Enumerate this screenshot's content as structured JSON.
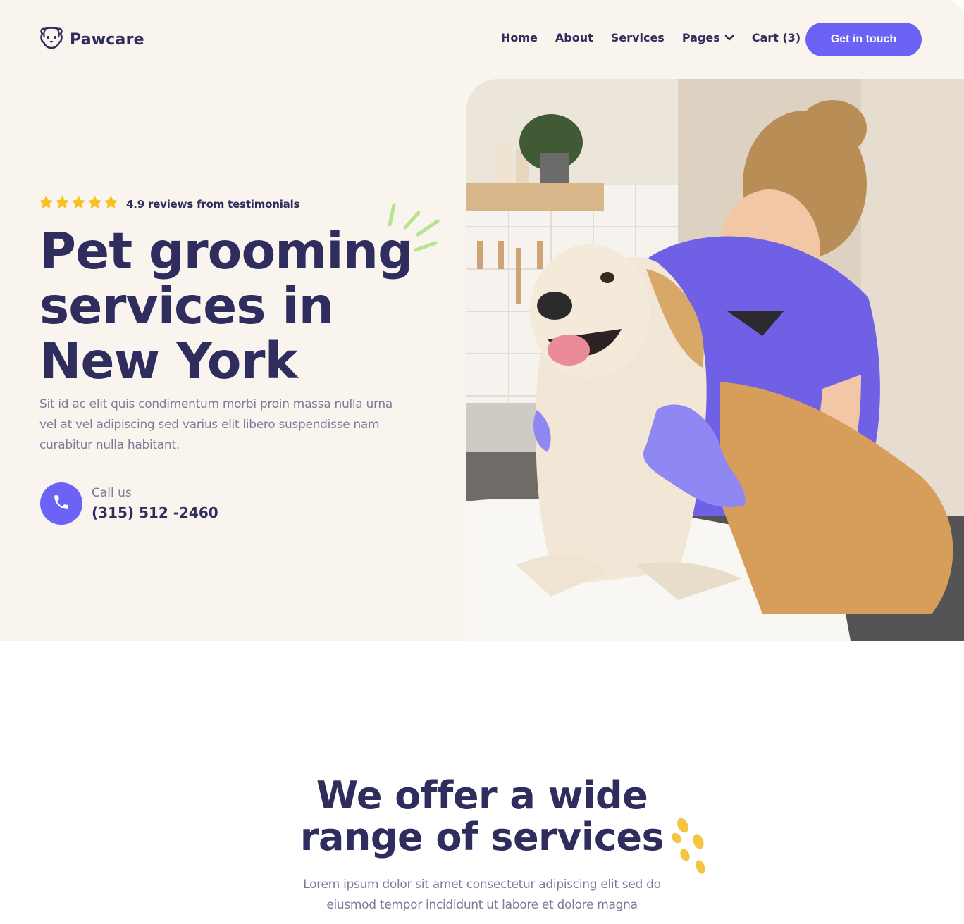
{
  "brand": {
    "name": "Pawcare",
    "logo_icon": "dog-face-icon"
  },
  "nav": {
    "items": [
      {
        "label": "Home"
      },
      {
        "label": "About"
      },
      {
        "label": "Services"
      },
      {
        "label": "Pages",
        "icon": "chevron-down-icon"
      },
      {
        "label": "Cart (3)"
      }
    ],
    "cta_label": "Get in touch"
  },
  "hero": {
    "rating": {
      "stars": 5,
      "text": "4.9 reviews from testimonials"
    },
    "title_lines": [
      "Pet grooming",
      "services in",
      "New York"
    ],
    "description": "Sit id ac elit quis condimentum morbi proin massa nulla urna vel at vel adipiscing sed varius elit libero suspendisse nam curabitur nulla habitant.",
    "call": {
      "label": "Call us",
      "number": "(315) 512 -2460",
      "icon": "phone-icon"
    },
    "image": "groomer-washing-golden-retriever-photo"
  },
  "services": {
    "title_lines": [
      "We offer a wide",
      "range of services"
    ],
    "description_lines": [
      "Lorem ipsum dolor sit amet consectetur adipiscing elit sed do",
      "eiusmod tempor incididunt ut labore et dolore magna"
    ]
  },
  "colors": {
    "primary": "#6c63f6",
    "heading": "#2f2c5e",
    "body_text": "#7e7a99",
    "hero_bg": "#f9f5ee",
    "star": "#fbbf24",
    "accent_green": "#b5e48c",
    "accent_yellow": "#f5c542"
  }
}
